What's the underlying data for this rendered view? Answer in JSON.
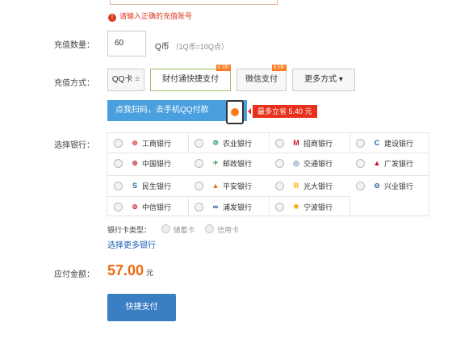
{
  "error_message": "请输入正确的充值账号",
  "quantity": {
    "label": "充值数量：",
    "value": "60",
    "unit": "Q币",
    "note": "（1Q币=10Q点）"
  },
  "payment_methods": {
    "label": "充值方式：",
    "options": [
      {
        "label": "QQ卡",
        "suffix": "≡",
        "selected": false
      },
      {
        "label": "财付通快捷支付",
        "badge": "9.5折",
        "selected": true
      },
      {
        "label": "微信支付",
        "badge": "9.5折",
        "selected": false
      },
      {
        "label": "更多方式 ▾",
        "selected": false
      }
    ]
  },
  "promo": {
    "text": "点我扫码，去手机QQ付款",
    "save_text": "最多立省 5.40 元"
  },
  "banks": {
    "label": "选择银行：",
    "items": [
      {
        "name": "工商银行",
        "icon": "icbc-icon",
        "glyph": "⊛",
        "color": "#d9261c"
      },
      {
        "name": "农业银行",
        "icon": "abc-icon",
        "glyph": "❁",
        "color": "#1a8f5a"
      },
      {
        "name": "招商银行",
        "icon": "cmb-icon",
        "glyph": "M",
        "color": "#c8102e"
      },
      {
        "name": "建设银行",
        "icon": "ccb-icon",
        "glyph": "C",
        "color": "#1a5fb4"
      },
      {
        "name": "中国银行",
        "icon": "boc-icon",
        "glyph": "⊕",
        "color": "#b0182a"
      },
      {
        "name": "邮政银行",
        "icon": "psbc-icon",
        "glyph": "✈",
        "color": "#1b8a3c"
      },
      {
        "name": "交通银行",
        "icon": "bocom-icon",
        "glyph": "◎",
        "color": "#1a3f8f"
      },
      {
        "name": "广发银行",
        "icon": "cgb-icon",
        "glyph": "▲",
        "color": "#c8102e"
      },
      {
        "name": "民生银行",
        "icon": "cmbc-icon",
        "glyph": "S",
        "color": "#1a6fa8"
      },
      {
        "name": "平安银行",
        "icon": "pingan-icon",
        "glyph": "▲",
        "color": "#f06a0f"
      },
      {
        "name": "光大银行",
        "icon": "ceb-icon",
        "glyph": "B",
        "color": "#f5b400"
      },
      {
        "name": "兴业银行",
        "icon": "cib-icon",
        "glyph": "⊖",
        "color": "#1a3f8f"
      },
      {
        "name": "中信银行",
        "icon": "citic-icon",
        "glyph": "⊚",
        "color": "#c8102e"
      },
      {
        "name": "浦发银行",
        "icon": "spdb-icon",
        "glyph": "∞",
        "color": "#1a3f8f"
      },
      {
        "name": "宁波银行",
        "icon": "nbcb-icon",
        "glyph": "✺",
        "color": "#f5a000"
      }
    ]
  },
  "card_type": {
    "label": "银行卡类型：",
    "options": [
      "储蓄卡",
      "信用卡"
    ]
  },
  "more_banks_link": "选择更多银行",
  "amount": {
    "label": "应付金额：",
    "value": "57.00",
    "currency": "元"
  },
  "pay_button": "快捷支付",
  "colors": {
    "accent": "#f06a0f",
    "primary": "#3a7ec4",
    "error": "#d9381e",
    "link": "#1a5fb4"
  }
}
